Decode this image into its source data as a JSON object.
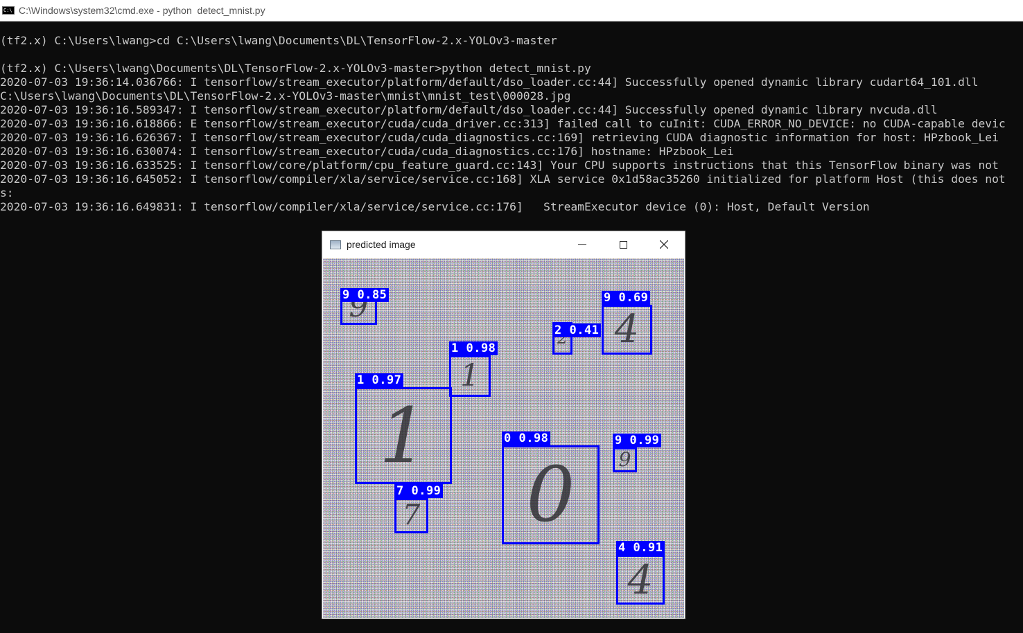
{
  "console_window": {
    "title": "C:\\Windows\\system32\\cmd.exe - python  detect_mnist.py",
    "icon": "cmd-icon",
    "lines": [
      "(tf2.x) C:\\Users\\lwang>cd C:\\Users\\lwang\\Documents\\DL\\TensorFlow-2.x-YOLOv3-master",
      "",
      "(tf2.x) C:\\Users\\lwang\\Documents\\DL\\TensorFlow-2.x-YOLOv3-master>python detect_mnist.py",
      "2020-07-03 19:36:14.036766: I tensorflow/stream_executor/platform/default/dso_loader.cc:44] Successfully opened dynamic library cudart64_101.dll",
      "C:\\Users\\lwang\\Documents\\DL\\TensorFlow-2.x-YOLOv3-master\\mnist\\mnist_test\\000028.jpg",
      "2020-07-03 19:36:16.589347: I tensorflow/stream_executor/platform/default/dso_loader.cc:44] Successfully opened dynamic library nvcuda.dll",
      "2020-07-03 19:36:16.618866: E tensorflow/stream_executor/cuda/cuda_driver.cc:313] failed call to cuInit: CUDA_ERROR_NO_DEVICE: no CUDA-capable devic",
      "2020-07-03 19:36:16.626367: I tensorflow/stream_executor/cuda/cuda_diagnostics.cc:169] retrieving CUDA diagnostic information for host: HPzbook_Lei",
      "2020-07-03 19:36:16.630074: I tensorflow/stream_executor/cuda/cuda_diagnostics.cc:176] hostname: HPzbook_Lei",
      "2020-07-03 19:36:16.633525: I tensorflow/core/platform/cpu_feature_guard.cc:143] Your CPU supports instructions that this TensorFlow binary was not",
      "2020-07-03 19:36:16.645052: I tensorflow/compiler/xla/service/service.cc:168] XLA service 0x1d58ac35260 initialized for platform Host (this does not",
      "s:",
      "2020-07-03 19:36:16.649831: I tensorflow/compiler/xla/service/service.cc:176]   StreamExecutor device (0): Host, Default Version"
    ]
  },
  "image_window": {
    "title": "predicted image",
    "icon": "image-window-icon",
    "controls": {
      "minimize": "─",
      "maximize": "☐",
      "close": "✕"
    },
    "box_color": "#0000ff",
    "detections": [
      {
        "label": "9 0.85",
        "digit": "9"
      },
      {
        "label": "9 0.69",
        "digit": "4"
      },
      {
        "label": "2 0.41",
        "digit": "2"
      },
      {
        "label": "1 0.98",
        "digit": "1"
      },
      {
        "label": "1 0.97",
        "digit": "1"
      },
      {
        "label": "0 0.98",
        "digit": "0"
      },
      {
        "label": "9 0.99",
        "digit": "9"
      },
      {
        "label": "7 0.99",
        "digit": "7"
      },
      {
        "label": "4 0.91",
        "digit": "4"
      }
    ]
  }
}
